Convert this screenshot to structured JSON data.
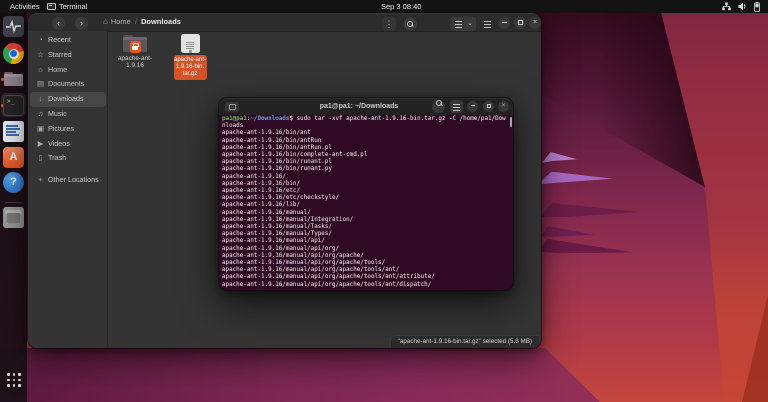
{
  "topbar": {
    "activities": "Activities",
    "app_name": "Terminal",
    "clock": "Sep 3 08:40",
    "tray_icons": [
      "network-icon",
      "volume-icon",
      "battery-icon"
    ]
  },
  "dock": {
    "items": [
      "system-monitor",
      "chrome",
      "files",
      "terminal",
      "libreoffice-writer",
      "ubuntu-software",
      "help",
      "storage-box"
    ],
    "running": [
      "files",
      "terminal"
    ],
    "active": "terminal",
    "software_letter": "A",
    "help_mark": "?"
  },
  "files_window": {
    "breadcrumb": {
      "home": "Home",
      "separator": "/",
      "current": "Downloads"
    },
    "sidebar": [
      {
        "icon": "recent-icon",
        "glyph": "◔",
        "label": "Recent"
      },
      {
        "icon": "starred-icon",
        "glyph": "☆",
        "label": "Starred"
      },
      {
        "icon": "home-icon",
        "glyph": "⌂",
        "label": "Home"
      },
      {
        "icon": "documents-icon",
        "glyph": "▤",
        "label": "Documents"
      },
      {
        "icon": "downloads-icon",
        "glyph": "↓",
        "label": "Downloads"
      },
      {
        "icon": "music-icon",
        "glyph": "♫",
        "label": "Music"
      },
      {
        "icon": "pictures-icon",
        "glyph": "▣",
        "label": "Pictures"
      },
      {
        "icon": "videos-icon",
        "glyph": "▶",
        "label": "Videos"
      },
      {
        "icon": "trash-icon",
        "glyph": "▯",
        "label": "Trash"
      },
      {
        "icon": "plus-icon",
        "glyph": "+",
        "label": "Other Locations"
      }
    ],
    "selected_item_index": 4,
    "items": [
      {
        "type": "folder",
        "label_lines": [
          "apache-ant-",
          "1.9.16"
        ],
        "selected": false
      },
      {
        "type": "archive",
        "label_lines": [
          "apache-ant-",
          "1.9.16-bin.",
          "tar.gz"
        ],
        "selected": true
      }
    ],
    "status_text": "\"apache-ant-1.9.16-bin.tar.gz\" selected (5.8 MB)"
  },
  "terminal_window": {
    "title": "pa1@pa1: ~/Downloads",
    "prompt_user": "pa1@pa1",
    "prompt_sep": ":",
    "prompt_path": "~/Downloads",
    "prompt_tail": "$ sudo tar -xvf apache-ant-1.9.16-bin.tar.gz -C /home/pa1/Dow",
    "output_lines": [
      "nloads",
      "apache-ant-1.9.16/bin/ant",
      "apache-ant-1.9.16/bin/antRun",
      "apache-ant-1.9.16/bin/antRun.pl",
      "apache-ant-1.9.16/bin/complete-ant-cmd.pl",
      "apache-ant-1.9.16/bin/runant.pl",
      "apache-ant-1.9.16/bin/runant.py",
      "apache-ant-1.9.16/",
      "apache-ant-1.9.16/bin/",
      "apache-ant-1.9.16/etc/",
      "apache-ant-1.9.16/etc/checkstyle/",
      "apache-ant-1.9.16/lib/",
      "apache-ant-1.9.16/manual/",
      "apache-ant-1.9.16/manual/Integration/",
      "apache-ant-1.9.16/manual/Tasks/",
      "apache-ant-1.9.16/manual/Types/",
      "apache-ant-1.9.16/manual/api/",
      "apache-ant-1.9.16/manual/api/org/",
      "apache-ant-1.9.16/manual/api/org/apache/",
      "apache-ant-1.9.16/manual/api/org/apache/tools/",
      "apache-ant-1.9.16/manual/api/org/apache/tools/ant/",
      "apache-ant-1.9.16/manual/api/org/apache/tools/ant/attribute/",
      "apache-ant-1.9.16/manual/api/org/apache/tools/ant/dispatch/"
    ]
  },
  "colors": {
    "selection_orange": "#d75128",
    "terminal_bg": "#300a24",
    "prompt_green": "#62c462",
    "prompt_blue": "#6d9fd4",
    "topbar_bg": "#131313",
    "header_bg": "#2c2c2c",
    "window_bg": "#343434"
  }
}
